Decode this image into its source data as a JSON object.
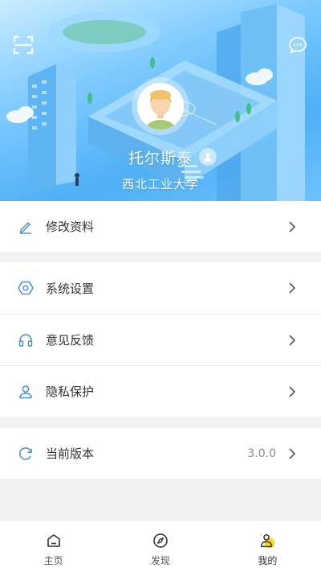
{
  "profile": {
    "name": "托尔斯泰",
    "school": "西北工业大学"
  },
  "menu": {
    "edit_profile": "修改资料",
    "settings": "系统设置",
    "feedback": "意见反馈",
    "privacy": "隐私保护",
    "version_label": "当前版本",
    "version_value": "3.0.0"
  },
  "tabs": [
    {
      "label": "主页"
    },
    {
      "label": "发现"
    },
    {
      "label": "我的"
    }
  ],
  "colors": {
    "accent": "#4a8fd8",
    "icon": "#4a8fd8",
    "active_tab_badge": "#ffd21f"
  },
  "icons": {
    "scan": "scan-icon",
    "message": "message-icon",
    "edit": "pencil-icon",
    "settings": "hexagon-gear-icon",
    "feedback": "headphones-icon",
    "privacy": "user-icon",
    "version": "refresh-icon",
    "home": "home-icon",
    "discover": "compass-icon",
    "mine": "person-icon"
  }
}
